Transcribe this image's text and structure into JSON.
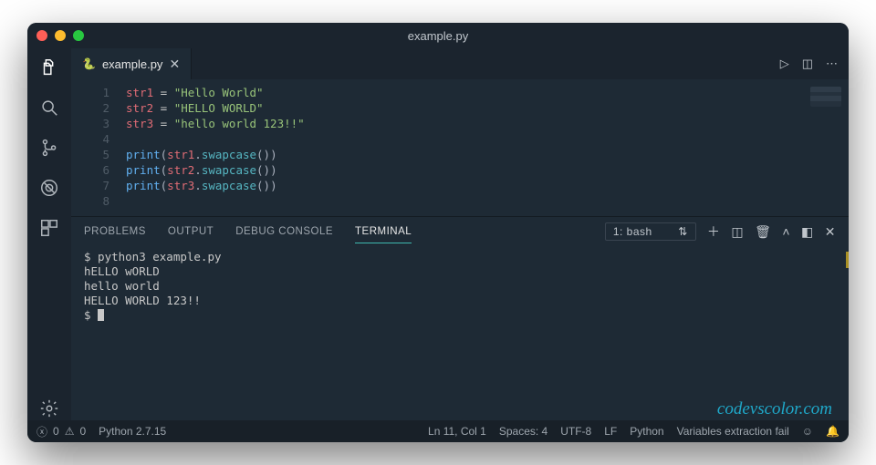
{
  "window": {
    "title": "example.py"
  },
  "tab": {
    "filename": "example.py"
  },
  "code": {
    "line1": {
      "var": "str1",
      "eq": " = ",
      "str": "\"Hello World\""
    },
    "line2": {
      "var": "str2",
      "eq": " = ",
      "str": "\"HELLO WORLD\""
    },
    "line3": {
      "var": "str3",
      "eq": " = ",
      "str": "\"hello world 123!!\""
    },
    "line5": {
      "fn": "print",
      "open": "(",
      "var": "str1",
      "dot": ".",
      "method": "swapcase",
      "call": "())"
    },
    "line6": {
      "fn": "print",
      "open": "(",
      "var": "str2",
      "dot": ".",
      "method": "swapcase",
      "call": "())"
    },
    "line7": {
      "fn": "print",
      "open": "(",
      "var": "str3",
      "dot": ".",
      "method": "swapcase",
      "call": "())"
    }
  },
  "gutter": [
    "1",
    "2",
    "3",
    "4",
    "5",
    "6",
    "7",
    "8"
  ],
  "panel": {
    "tabs": {
      "problems": "PROBLEMS",
      "output": "OUTPUT",
      "debug": "DEBUG CONSOLE",
      "terminal": "TERMINAL"
    },
    "selector": "1: bash"
  },
  "terminal": {
    "cmd": "$ python3 example.py",
    "out1": "hELLO wORLD",
    "out2": "hello world",
    "out3": "HELLO WORLD 123!!",
    "prompt": "$ "
  },
  "watermark": "codevscolor.com",
  "status": {
    "errors": "0",
    "warnings": "0",
    "python": "Python 2.7.15",
    "pos": "Ln 11, Col 1",
    "spaces": "Spaces: 4",
    "encoding": "UTF-8",
    "eol": "LF",
    "lang": "Python",
    "msg": "Variables extraction fail"
  }
}
